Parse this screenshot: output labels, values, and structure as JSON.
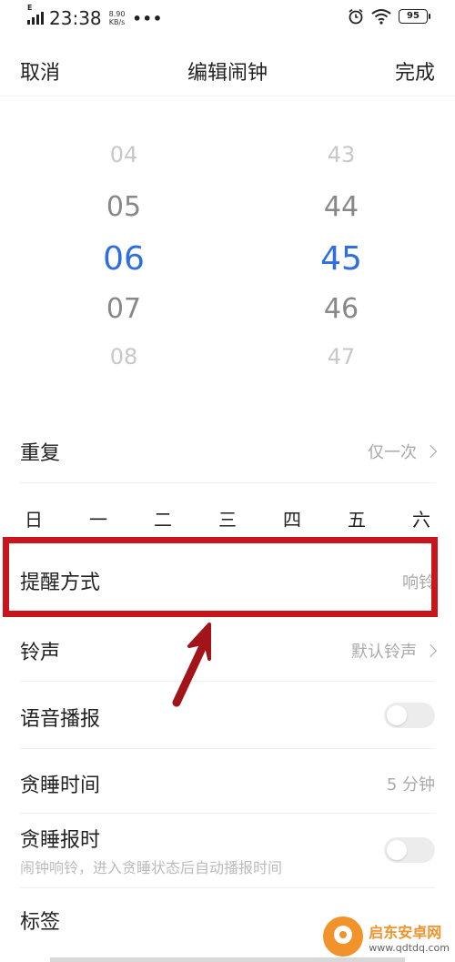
{
  "status_bar": {
    "network_type": "E",
    "time": "23:38",
    "net_speed_value": "8.90",
    "net_speed_unit": "KB/s",
    "more": "•••",
    "battery": "95"
  },
  "header": {
    "cancel_label": "取消",
    "title": "编辑闹钟",
    "done_label": "完成"
  },
  "time_picker": {
    "hours": [
      "04",
      "05",
      "06",
      "07",
      "08"
    ],
    "minutes": [
      "43",
      "44",
      "45",
      "46",
      "47"
    ],
    "selected_hour": "06",
    "selected_minute": "45",
    "accent_color": "#2f6ee0"
  },
  "repeat": {
    "label": "重复",
    "value": "仅一次",
    "days": [
      "日",
      "一",
      "二",
      "三",
      "四",
      "五",
      "六"
    ]
  },
  "reminder_mode": {
    "label": "提醒方式",
    "value": "响铃"
  },
  "ringtone": {
    "label": "铃声",
    "value": "默认铃声"
  },
  "voice_broadcast": {
    "label": "语音播报",
    "enabled": false
  },
  "snooze_time": {
    "label": "贪睡时间",
    "value": "5 分钟"
  },
  "snooze_report": {
    "label": "贪睡报时",
    "description": "闹钟响铃，进入贪睡状态后自动播报时间",
    "enabled": false
  },
  "tag": {
    "label": "标签"
  },
  "annotation": {
    "highlight_color": "#c8161d"
  },
  "watermark": {
    "name": "启东安卓网",
    "url": "www.qdtdq.com"
  }
}
